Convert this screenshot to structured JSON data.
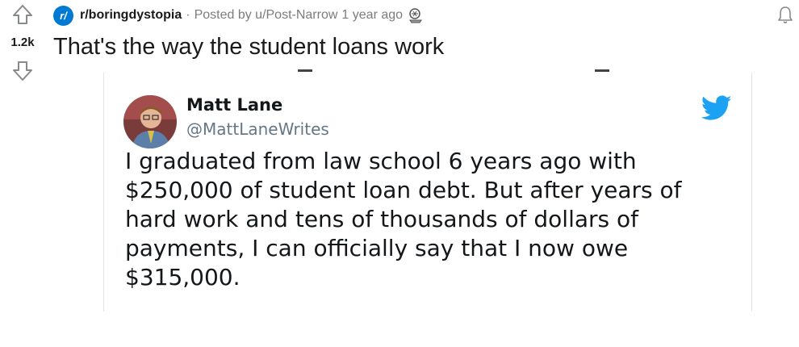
{
  "vote": {
    "count": "1.2k"
  },
  "meta": {
    "subreddit_icon_text": "r/",
    "subreddit": "r/boringdystopia",
    "separator": "·",
    "posted_by": "Posted by u/Post-Narrow",
    "age": "1 year ago"
  },
  "post": {
    "title": "That's the way the student loans work"
  },
  "tweet": {
    "author_name": "Matt Lane",
    "author_handle": "@MattLaneWrites",
    "text": "I graduated from law school 6 years ago with\n$250,000 of student loan debt. But after years of\nhard work and tens of thousands of dollars of\npayments, I can officially say that I now owe\n$315,000."
  },
  "colors": {
    "accent": "#0079d3",
    "twitter_blue": "#1da1f2",
    "text": "#1a1a1b",
    "muted": "#7c7c7c"
  },
  "icons": {
    "upvote": "arrow-up-icon",
    "downvote": "arrow-down-icon",
    "award": "award-icon",
    "notify": "bell-icon",
    "twitter": "twitter-bird-icon"
  }
}
